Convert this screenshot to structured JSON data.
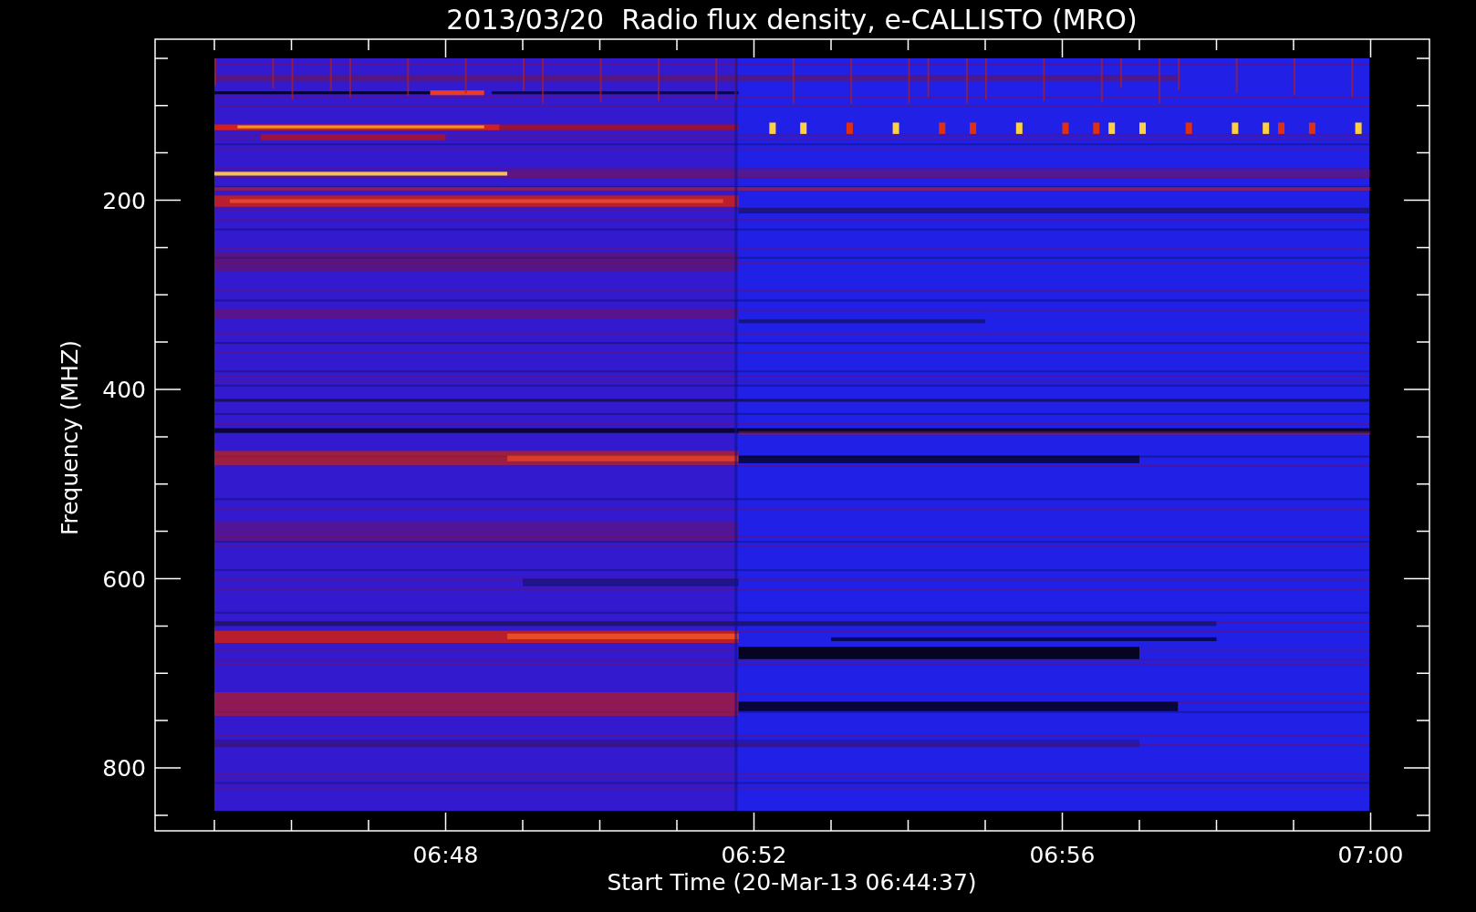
{
  "title": "2013/03/20  Radio flux density, e-CALLISTO (MRO)",
  "y_axis": {
    "label": "Frequency (MHZ)",
    "ticks": [
      "200",
      "400",
      "600",
      "800"
    ]
  },
  "x_axis": {
    "label": "Start Time (20-Mar-13 06:44:37)",
    "ticks": [
      "06:48",
      "06:52",
      "06:56",
      "07:00"
    ]
  }
}
